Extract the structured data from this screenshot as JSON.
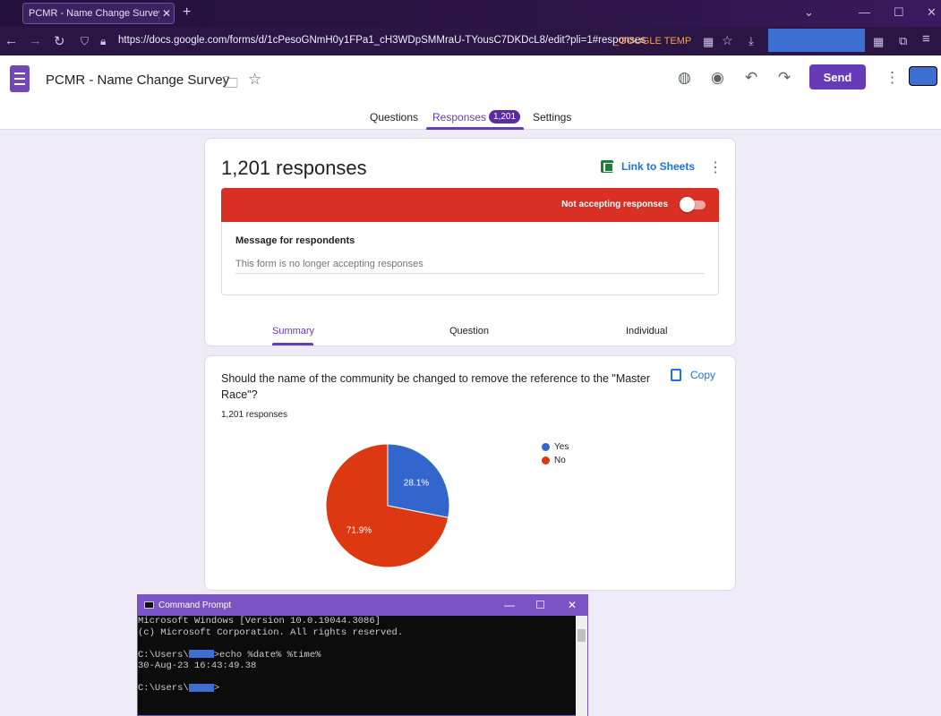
{
  "browser": {
    "tab_title": "PCMR - Name Change Survey - Goo",
    "tab_close": "✕",
    "new_tab": "+",
    "url": "https://docs.google.com/forms/d/1cPesoGNmH0y1FPa1_cH3WDpSMMraU-TYousC7DKDcL8/edit?pli=1#responses",
    "bookmark": "_GOOGLE TEMP"
  },
  "forms_header": {
    "title": "PCMR - Name Change Survey",
    "send_label": "Send",
    "tabs": [
      {
        "label": "Questions"
      },
      {
        "label": "Responses"
      },
      {
        "label": "Settings"
      }
    ],
    "responses_badge": "1,201"
  },
  "summary_card": {
    "count_label": "1,201 responses",
    "sheets_link": "Link to Sheets",
    "not_accepting": "Not accepting responses",
    "accepting_toggle": false,
    "message_label": "Message for respondents",
    "message_value": "This form is no longer accepting responses",
    "sub_tabs": [
      {
        "label": "Summary"
      },
      {
        "label": "Question"
      },
      {
        "label": "Individual"
      }
    ]
  },
  "question_card": {
    "question": "Should the name of the community be changed to remove the reference to the \"Master Race\"?",
    "response_count": "1,201 responses",
    "copy_label": "Copy"
  },
  "chart_data": {
    "type": "pie",
    "categories": [
      "Yes",
      "No"
    ],
    "values": [
      28.1,
      71.9
    ],
    "value_labels": [
      "28.1%",
      "71.9%"
    ],
    "colors": [
      "#3366cc",
      "#dc3912"
    ],
    "legend_placement": "top-right"
  },
  "cmd": {
    "title": "Command Prompt",
    "lines": [
      "Microsoft Windows [Version 10.0.19044.3086]",
      "(c) Microsoft Corporation. All rights reserved.",
      "",
      "C:\\Users\\",
      "30-Aug-23 16:43:49.38",
      "",
      "C:\\Users\\"
    ],
    "command_suffix": ">echo %date% %time%",
    "prompt_suffix": ">"
  }
}
